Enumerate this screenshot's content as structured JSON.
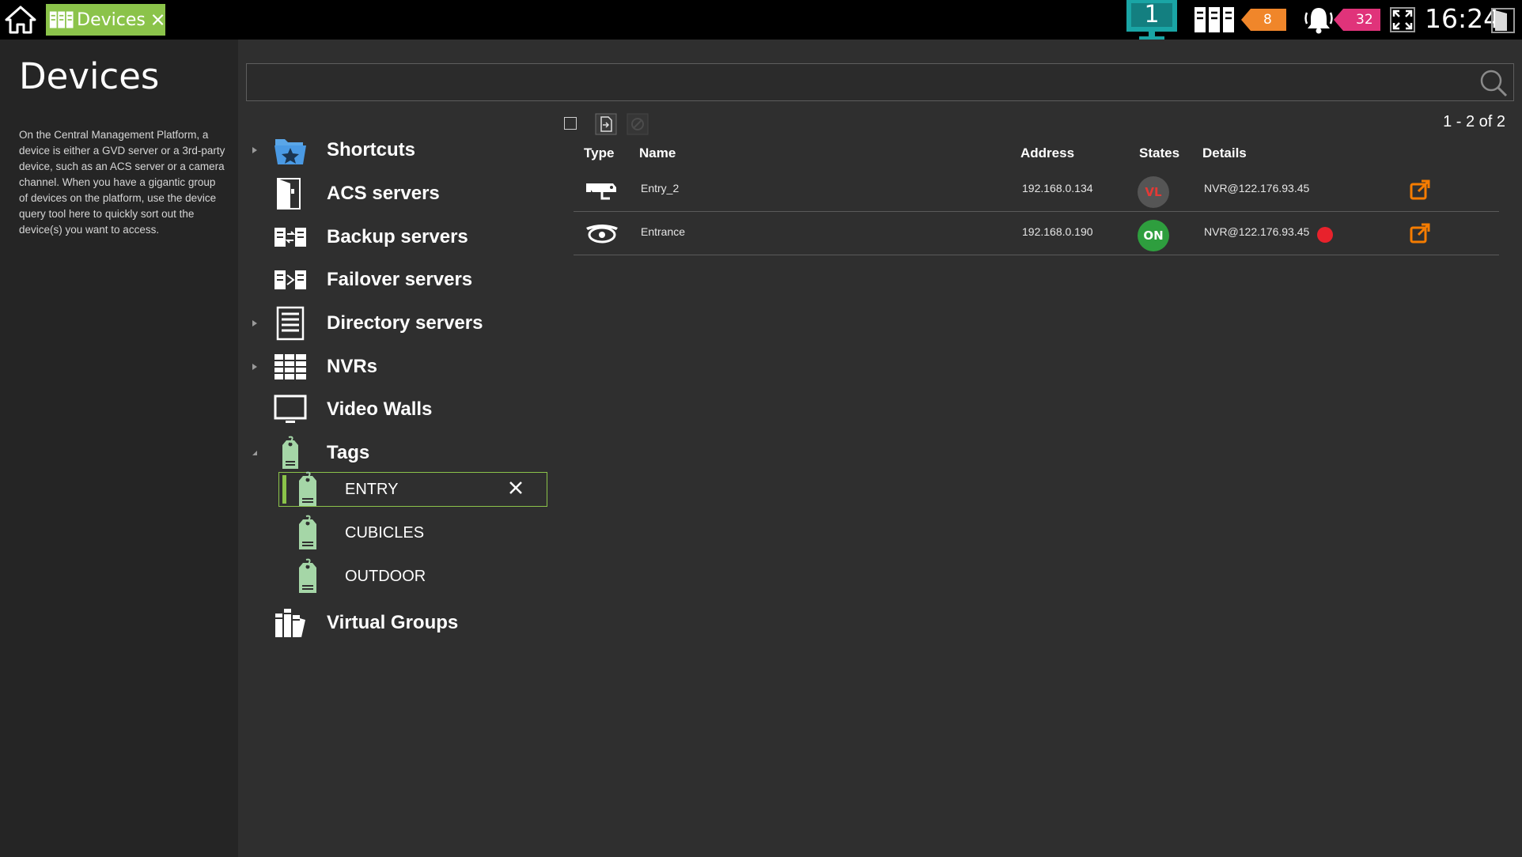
{
  "topbar": {
    "tab_label": "Devices",
    "monitor_number": "1",
    "device_alert_count": "8",
    "alarm_count": "32",
    "clock": "16:24"
  },
  "sidebar": {
    "title": "Devices",
    "description": "On the Central Management Platform, a device is either a GVD server or a 3rd-party device, such as an ACS server or a camera channel. When you have a gigantic group of devices on the platform, use the device query tool here to quickly sort out the device(s) you want to access."
  },
  "search": {
    "placeholder": ""
  },
  "tree": {
    "items": [
      {
        "label": "Shortcuts",
        "icon": "shortcuts-folder-star-icon"
      },
      {
        "label": "ACS servers",
        "icon": "door-icon"
      },
      {
        "label": "Backup servers",
        "icon": "backup-server-icon"
      },
      {
        "label": "Failover servers",
        "icon": "failover-server-icon"
      },
      {
        "label": "Directory servers",
        "icon": "directory-server-icon"
      },
      {
        "label": "NVRs",
        "icon": "nvr-icon"
      },
      {
        "label": "Video Walls",
        "icon": "monitor-icon"
      },
      {
        "label": "Tags",
        "icon": "tag-icon"
      },
      {
        "label": "Virtual Groups",
        "icon": "virtual-groups-icon"
      }
    ],
    "tags": [
      {
        "label": "ENTRY",
        "selected": true
      },
      {
        "label": "CUBICLES",
        "selected": false
      },
      {
        "label": "OUTDOOR",
        "selected": false
      }
    ]
  },
  "table": {
    "pager": "1 - 2 of 2",
    "headers": {
      "type": "Type",
      "name": "Name",
      "address": "Address",
      "states": "States",
      "details": "Details"
    },
    "rows": [
      {
        "type_icon": "bullet-camera-icon",
        "name": "Entry_2",
        "address": "192.168.0.134",
        "state": "VL",
        "state_color": "#555555",
        "details": "NVR@122.176.93.45",
        "recording": false
      },
      {
        "type_icon": "dome-camera-icon",
        "name": "Entrance",
        "address": "192.168.0.190",
        "state": "ON",
        "state_color": "#2e9e3e",
        "details": "NVR@122.176.93.45",
        "recording": true
      }
    ]
  },
  "colors": {
    "accent_green": "#8bc34a",
    "tag_green": "#a5d6a7",
    "orange": "#f0862a",
    "pink": "#e0337a",
    "link_orange": "#f57c00"
  }
}
